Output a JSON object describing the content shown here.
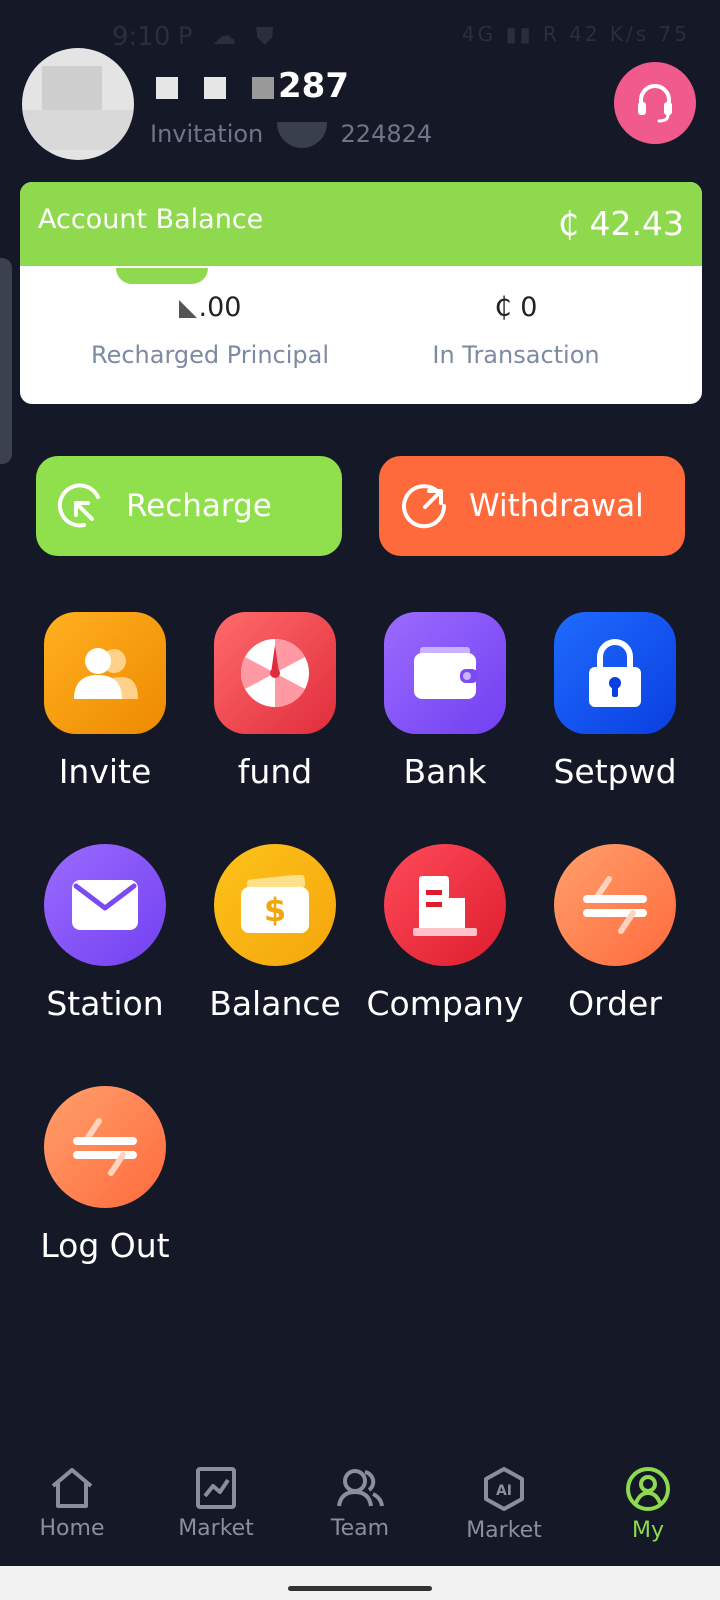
{
  "status_bar": {
    "time": "9:10",
    "icons": "P ☁ ⛊",
    "right": "4G ▮▮ R 42 K/s 75"
  },
  "header": {
    "username": "287",
    "invitation_label": "Invitation",
    "invitation_code": "224824"
  },
  "balance_card": {
    "title": "Account Balance",
    "amount": "₵ 42.43",
    "recharged_value": ".00",
    "recharged_label": "Recharged Principal",
    "transaction_value": "₵  0",
    "transaction_label": "In Transaction"
  },
  "actions": {
    "recharge": "Recharge",
    "withdrawal": "Withdrawal"
  },
  "grid": [
    {
      "label": "Invite",
      "icon": "user-group-icon"
    },
    {
      "label": "fund",
      "icon": "wheel-icon"
    },
    {
      "label": "Bank",
      "icon": "wallet-icon"
    },
    {
      "label": "Setpwd",
      "icon": "lock-icon"
    },
    {
      "label": "Station",
      "icon": "mail-icon"
    },
    {
      "label": "Balance",
      "icon": "money-icon"
    },
    {
      "label": "Company",
      "icon": "building-icon"
    },
    {
      "label": "Order",
      "icon": "transfer-icon"
    },
    {
      "label": "Log Out",
      "icon": "transfer-icon"
    }
  ],
  "nav": [
    {
      "label": "Home",
      "icon": "home-icon"
    },
    {
      "label": "Market",
      "icon": "chart-icon"
    },
    {
      "label": "Team",
      "icon": "team-icon"
    },
    {
      "label": "Market",
      "icon": "ai-icon"
    },
    {
      "label": "My",
      "icon": "profile-icon"
    }
  ],
  "colors": {
    "background": "#141827",
    "green": "#8fd94f",
    "orange": "#ff6a3d",
    "pink": "#f15a8c"
  }
}
